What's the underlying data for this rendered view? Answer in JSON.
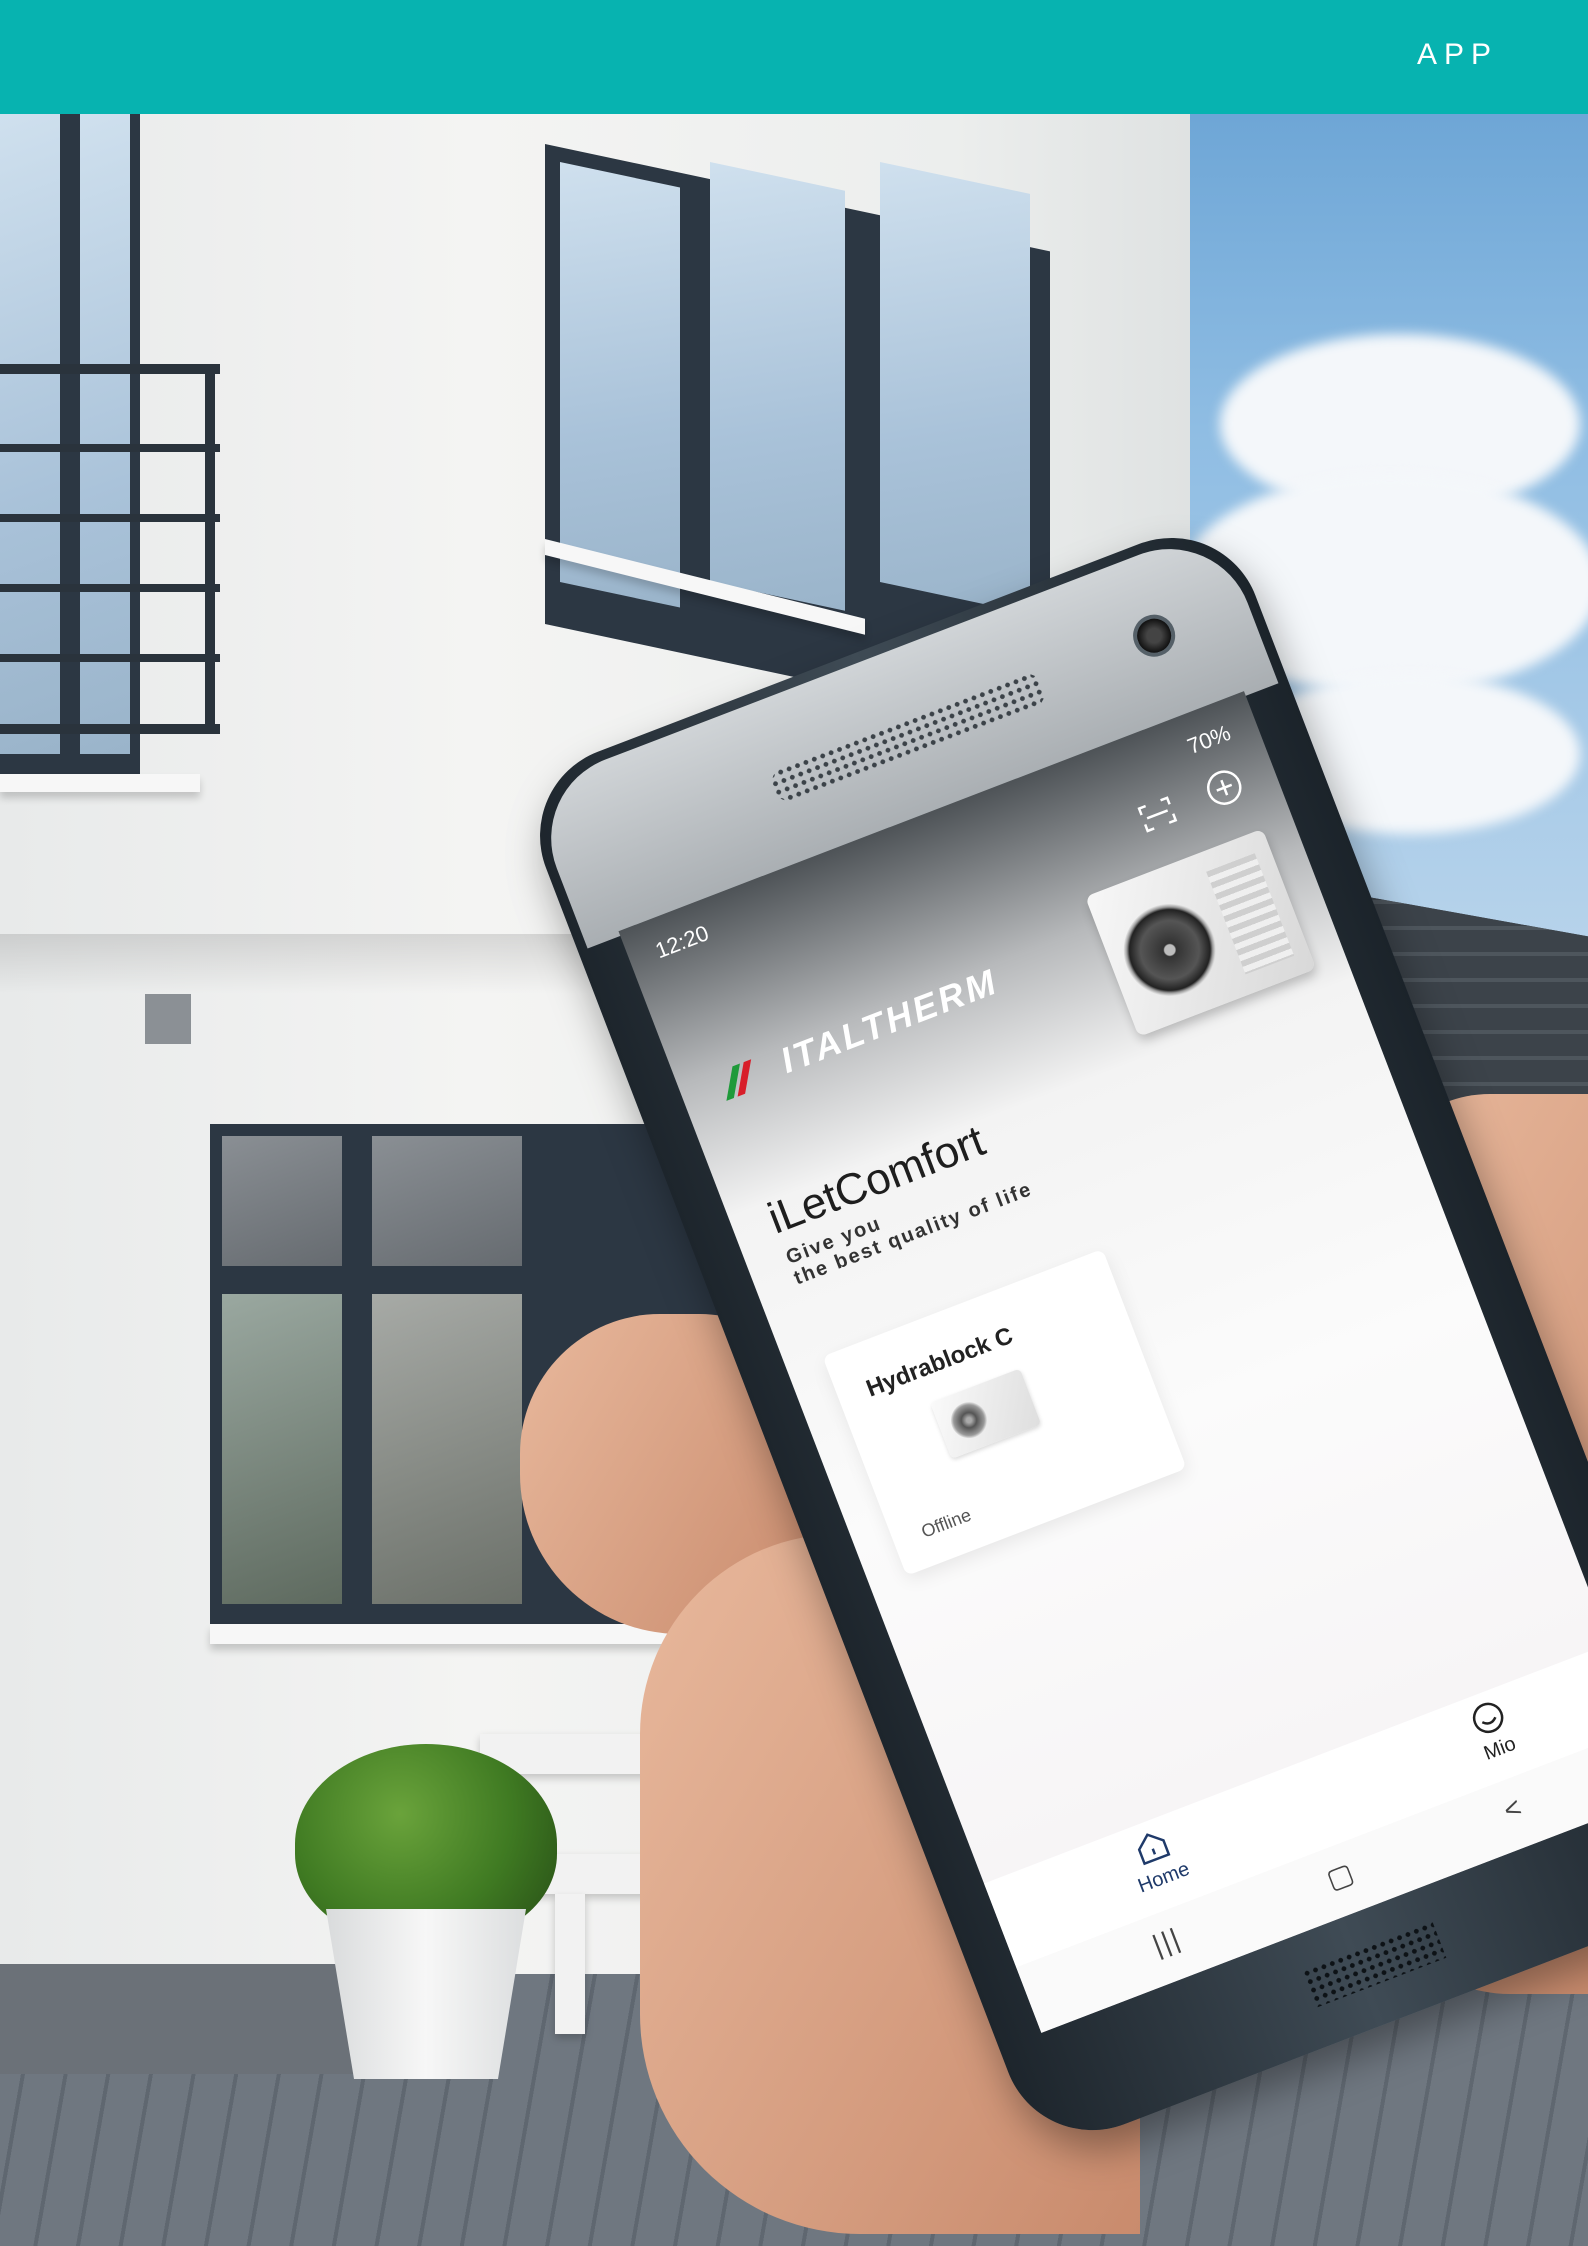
{
  "header": {
    "section_label": "APP",
    "background_color": "#07b3b0"
  },
  "phone_app": {
    "status_bar": {
      "time": "12:20",
      "indicators": "70%"
    },
    "toolbar": {
      "scan_icon": "scan-icon",
      "add_icon": "add-circle-icon"
    },
    "brand": {
      "name": "ITALTHERM",
      "logo_colors": [
        "#1f9a3a",
        "#d81e2a"
      ]
    },
    "app_name": "iLetComfort",
    "tagline": "Give you\nthe best quality of life",
    "devices": [
      {
        "name": "Hydrablock C",
        "status": "Offline"
      }
    ],
    "tabs": [
      {
        "label": "Home",
        "icon": "home-icon"
      },
      {
        "label": "Mio",
        "icon": "profile-icon"
      }
    ],
    "system_nav": {
      "recent": "|||",
      "home": "▢",
      "back": "<"
    }
  }
}
